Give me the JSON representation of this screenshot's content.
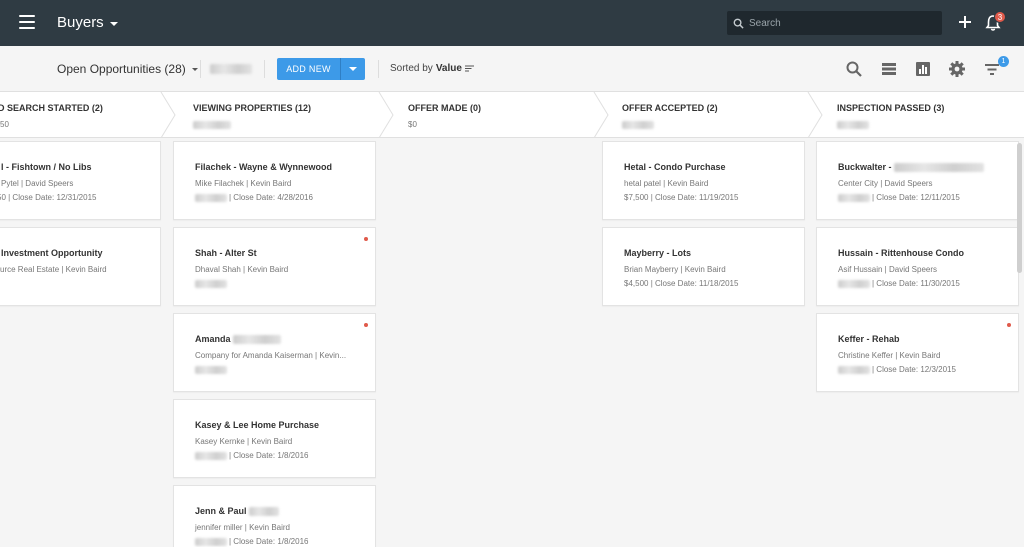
{
  "header": {
    "app_title": "Buyers",
    "search_placeholder": "Search",
    "notifications_count": "3"
  },
  "toolbar": {
    "pipeline_label": "Open Opportunities (28)",
    "add_new_label": "ADD NEW",
    "sorted_prefix": "Sorted by",
    "sorted_value": "Value",
    "filter_count": "1"
  },
  "stages": [
    {
      "name": "D SEARCH STARTED (2)",
      "value": "50"
    },
    {
      "name": "VIEWING PROPERTIES (12)",
      "value": ""
    },
    {
      "name": "OFFER MADE (0)",
      "value": "$0"
    },
    {
      "name": "OFFER ACCEPTED (2)",
      "value": ""
    },
    {
      "name": "INSPECTION PASSED (3)",
      "value": ""
    }
  ],
  "columns": [
    {
      "cards": [
        {
          "title": "l - Fishtown / No Libs",
          "contacts": "Pytel | David Speers",
          "meta": "50 | Close Date: 12/31/2015",
          "dot": false
        },
        {
          "title": "Investment Opportunity",
          "contacts": "urce Real Estate | Kevin Baird",
          "meta": "",
          "dot": false
        }
      ]
    },
    {
      "cards": [
        {
          "title": "Filachek - Wayne & Wynnewood",
          "contacts": "Mike Filachek | Kevin Baird",
          "meta": "| Close Date: 4/28/2016",
          "dot": false
        },
        {
          "title": "Shah - Alter St",
          "contacts": "Dhaval Shah | Kevin Baird",
          "meta": "",
          "dot": true
        },
        {
          "title": "Amanda",
          "contacts": "Company for Amanda Kaiserman | Kevin...",
          "meta": "",
          "dot": true
        },
        {
          "title": "Kasey & Lee Home Purchase",
          "contacts": "Kasey Kernke | Kevin Baird",
          "meta": "| Close Date: 1/8/2016",
          "dot": false
        },
        {
          "title": "Jenn & Paul",
          "contacts": "jennifer miller | Kevin Baird",
          "meta": "| Close Date: 1/8/2016",
          "dot": false
        }
      ]
    },
    {
      "cards": []
    },
    {
      "cards": [
        {
          "title": "Hetal - Condo Purchase",
          "contacts": "hetal patel | Kevin Baird",
          "meta": "$7,500 | Close Date: 11/19/2015",
          "dot": false
        },
        {
          "title": "Mayberry - Lots",
          "contacts": "Brian Mayberry | Kevin Baird",
          "meta": "$4,500 | Close Date: 11/18/2015",
          "dot": false
        }
      ]
    },
    {
      "cards": [
        {
          "title": "Buckwalter -",
          "contacts": "Center City | David Speers",
          "meta": "| Close Date: 12/11/2015",
          "dot": false
        },
        {
          "title": "Hussain - Rittenhouse Condo",
          "contacts": "Asif Hussain | David Speers",
          "meta": "| Close Date: 11/30/2015",
          "dot": false
        },
        {
          "title": "Keffer - Rehab",
          "contacts": "Christine Keffer | Kevin Baird",
          "meta": "| Close Date: 12/3/2015",
          "dot": true
        }
      ]
    }
  ],
  "colors": {
    "topbar": "#2f3b43",
    "accent": "#3d9ae8",
    "alert": "#e05a4b"
  }
}
